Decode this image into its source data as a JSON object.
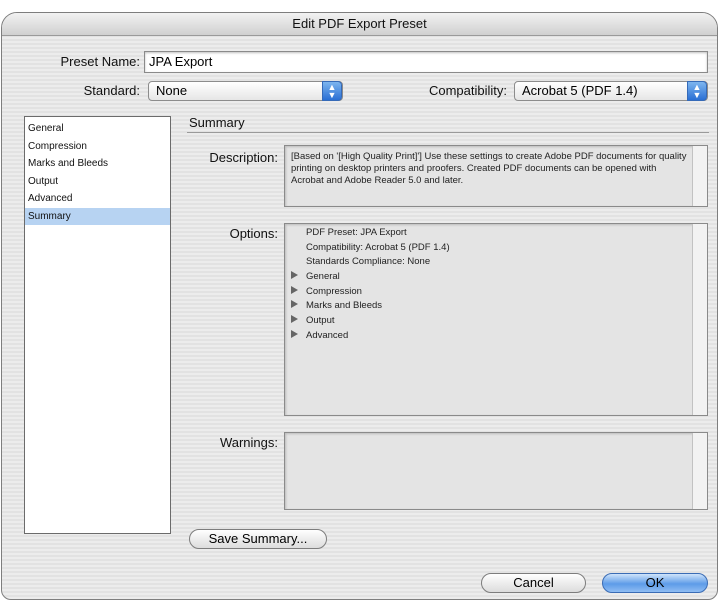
{
  "window": {
    "title": "Edit PDF Export Preset"
  },
  "preset": {
    "label": "Preset Name:",
    "value": "JPA Export"
  },
  "standard": {
    "label": "Standard:",
    "selected": "None"
  },
  "compatibility": {
    "label": "Compatibility:",
    "selected": "Acrobat 5 (PDF 1.4)"
  },
  "sidebar": {
    "items": [
      {
        "label": "General"
      },
      {
        "label": "Compression"
      },
      {
        "label": "Marks and Bleeds"
      },
      {
        "label": "Output"
      },
      {
        "label": "Advanced"
      },
      {
        "label": "Summary"
      }
    ],
    "selected_index": 5
  },
  "summary": {
    "title": "Summary",
    "description_label": "Description:",
    "description_text": "[Based on '[High Quality Print]'] Use these settings to create Adobe PDF documents for quality printing on desktop printers and proofers.  Created PDF documents can be opened with Acrobat and Adobe Reader 5.0 and later.",
    "options_label": "Options:",
    "options": {
      "preset": "PDF Preset: JPA Export",
      "compatibility": "Compatibility: Acrobat 5 (PDF 1.4)",
      "standards": "Standards Compliance: None",
      "groups": [
        "General",
        "Compression",
        "Marks and Bleeds",
        "Output",
        "Advanced"
      ]
    },
    "warnings_label": "Warnings:"
  },
  "buttons": {
    "save_summary": "Save Summary...",
    "cancel": "Cancel",
    "ok": "OK"
  },
  "colors": {
    "selection": "#b7d3f2",
    "accent": "#2a6fd4"
  },
  "icons": {
    "popup_arrows": "up-down-arrows-icon",
    "disclosure": "disclosure-triangle-icon"
  }
}
